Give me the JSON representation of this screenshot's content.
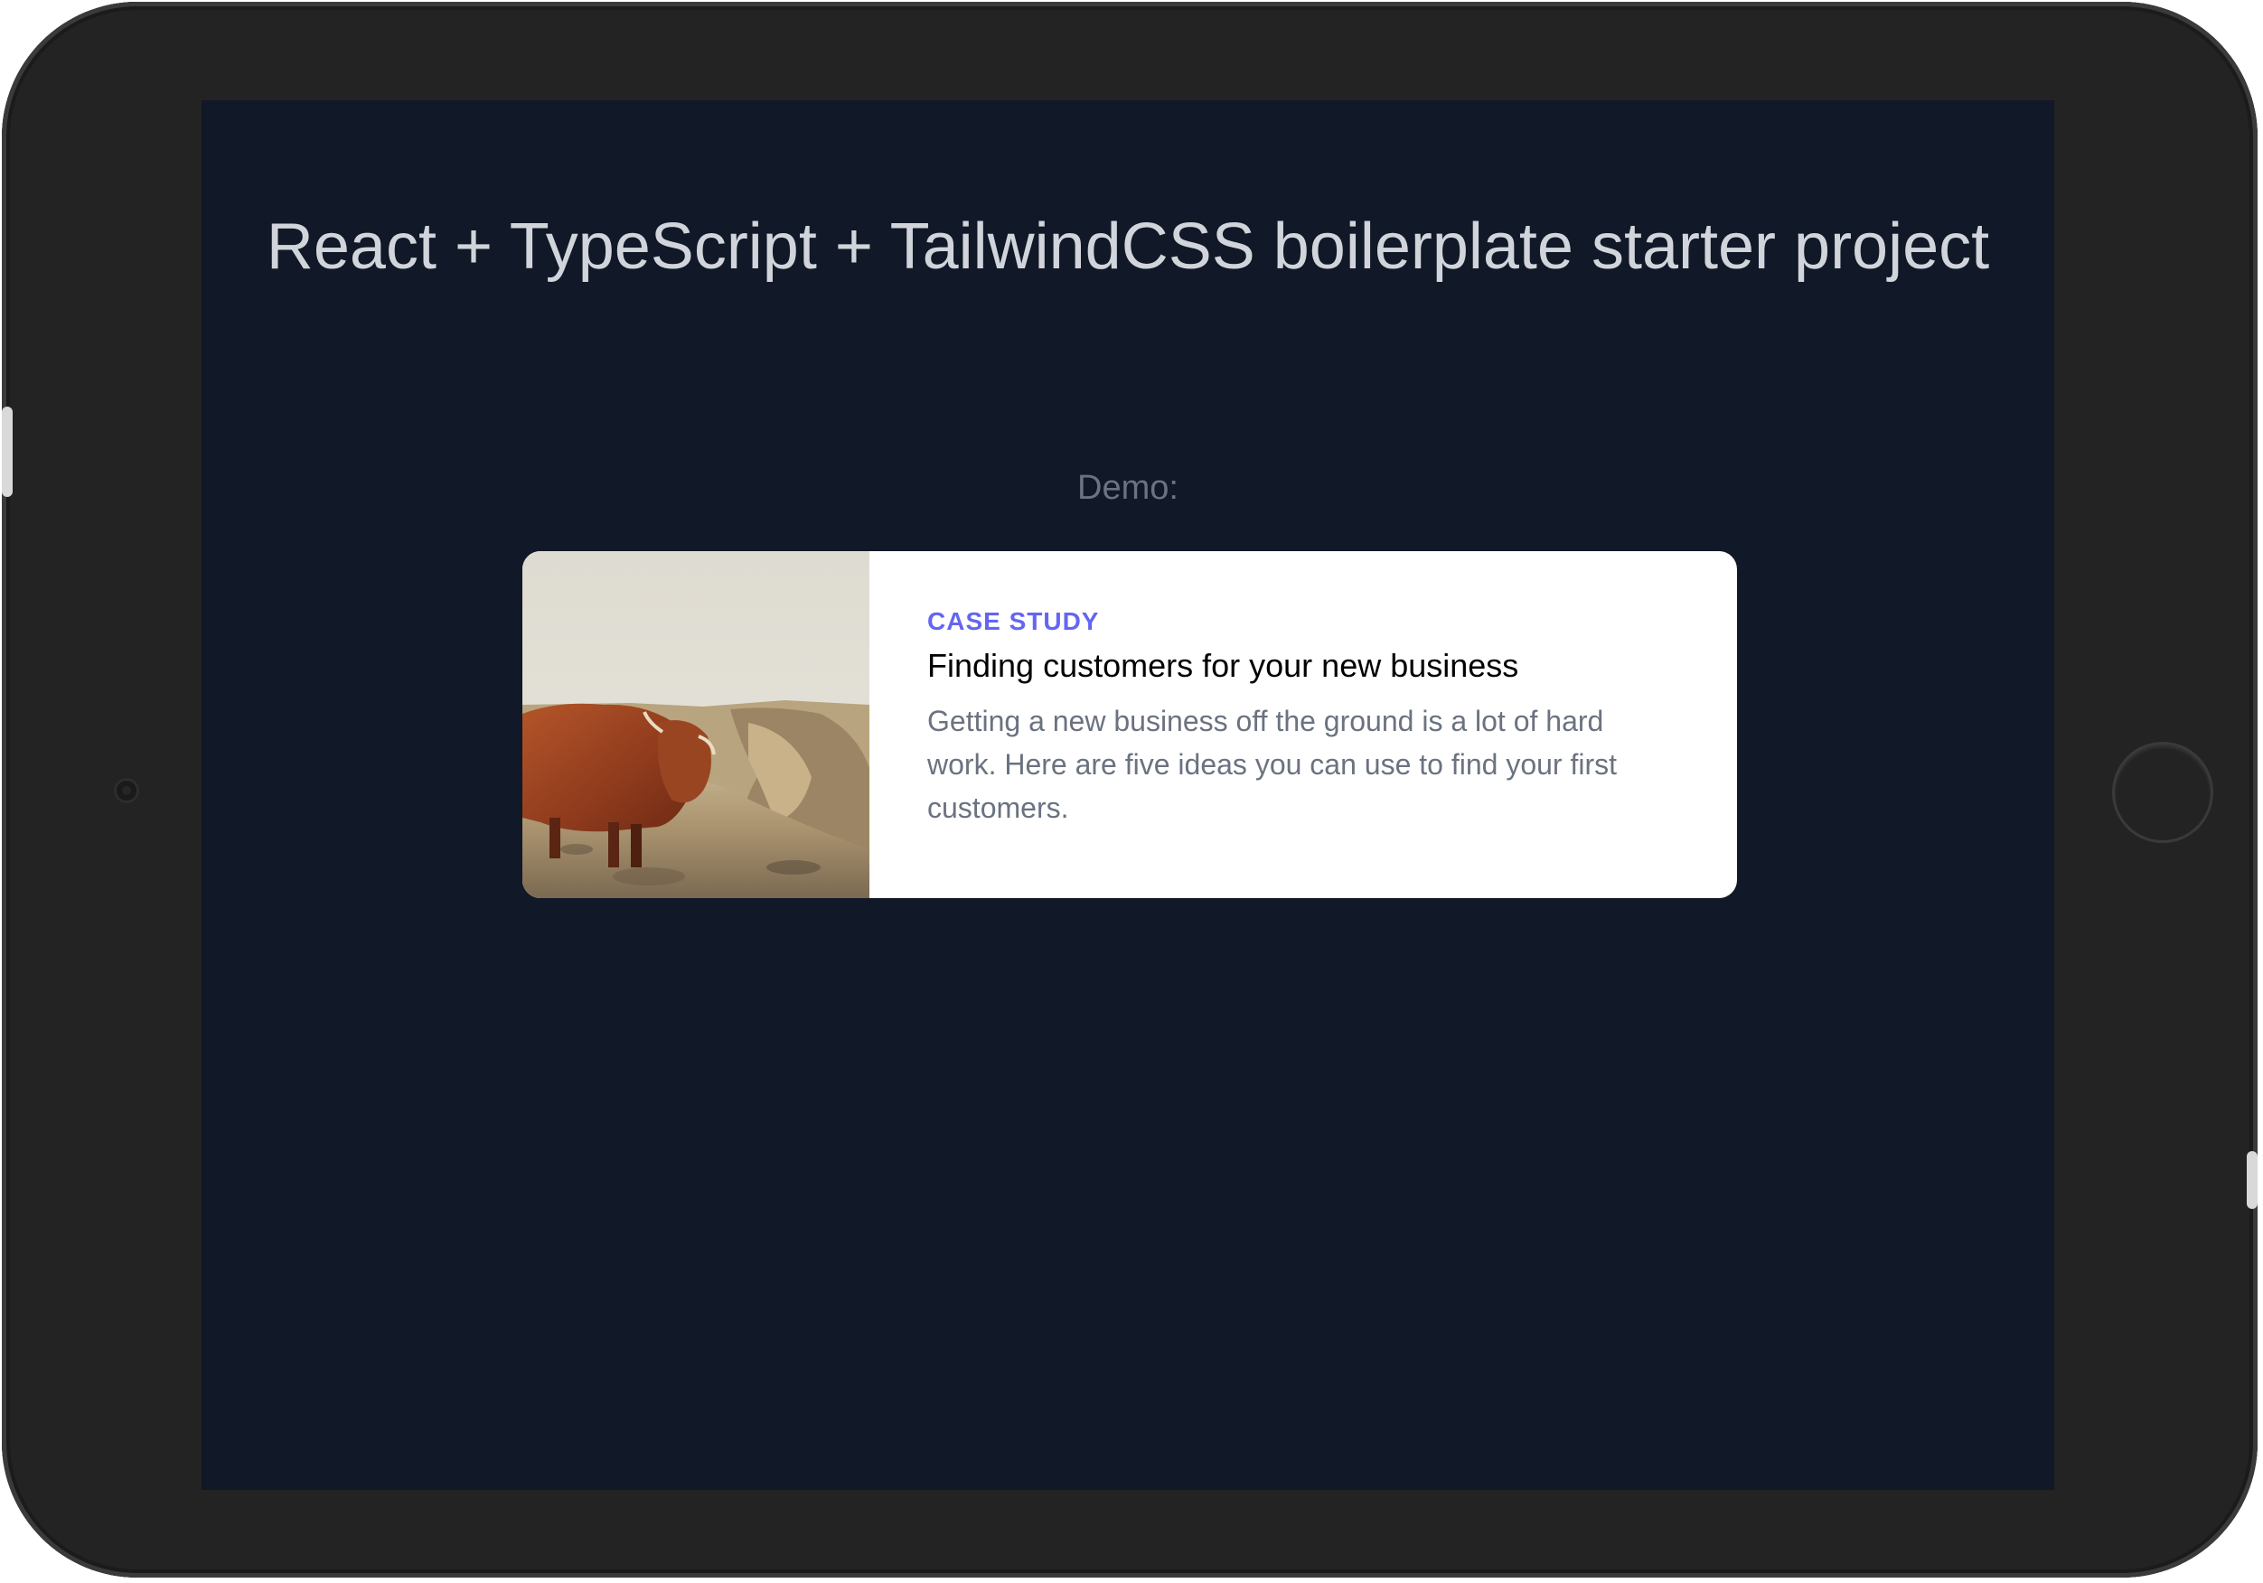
{
  "page": {
    "title": "React + TypeScript + TailwindCSS boilerplate starter project",
    "demo_label": "Demo:"
  },
  "card": {
    "eyebrow": "Case study",
    "title": "Finding customers for your new business",
    "description": "Getting a new business off the ground is a lot of hard work. Here are five ideas you can use to find your first customers."
  },
  "colors": {
    "screen_background": "#111827",
    "title_text": "#d1d5db",
    "muted_text": "#6b7280",
    "accent": "#6366f1",
    "card_background": "#ffffff",
    "device_frame": "#232323"
  }
}
